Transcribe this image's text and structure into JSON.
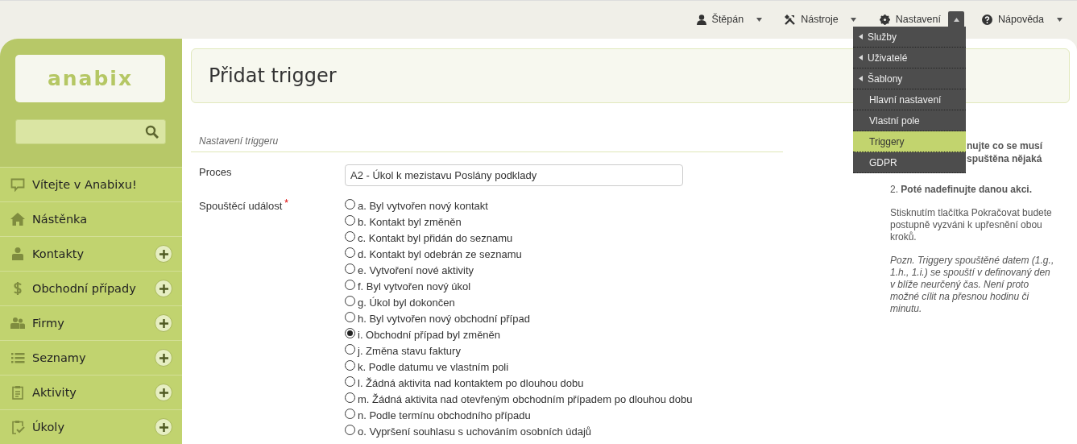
{
  "topbar": {
    "items": [
      {
        "label": "Štěpán",
        "expanded": false
      },
      {
        "label": "Nástroje",
        "expanded": false
      },
      {
        "label": "Nastavení",
        "expanded": true
      },
      {
        "label": "Nápověda",
        "expanded": false
      }
    ]
  },
  "settings_menu": {
    "items": [
      {
        "label": "Služby",
        "submenu": true,
        "selected": false
      },
      {
        "label": "Uživatelé",
        "submenu": true,
        "selected": false
      },
      {
        "label": "Šablony",
        "submenu": true,
        "selected": false
      },
      {
        "label": "Hlavní nastavení",
        "submenu": false,
        "selected": false
      },
      {
        "label": "Vlastní pole",
        "submenu": false,
        "selected": false
      },
      {
        "label": "Triggery",
        "submenu": false,
        "selected": true
      },
      {
        "label": "GDPR",
        "submenu": false,
        "selected": false
      }
    ]
  },
  "sidebar": {
    "logo": "anabix",
    "items": [
      {
        "label": "Vítejte v Anabixu!",
        "add_button": false
      },
      {
        "label": "Nástěnka",
        "add_button": false
      },
      {
        "label": "Kontakty",
        "add_button": true
      },
      {
        "label": "Obchodní případy",
        "add_button": true
      },
      {
        "label": "Firmy",
        "add_button": true
      },
      {
        "label": "Seznamy",
        "add_button": true
      },
      {
        "label": "Aktivity",
        "add_button": true
      },
      {
        "label": "Úkoly",
        "add_button": true
      }
    ]
  },
  "page": {
    "title": "Přidat trigger"
  },
  "form": {
    "section": "Nastavení triggeru",
    "process": {
      "label": "Proces",
      "value": "A2 - Úkol k mezistavu Poslány podklady"
    },
    "event": {
      "label": "Spouštěcí událost",
      "required_mark": "*",
      "options": [
        {
          "label": "a. Byl vytvořen nový kontakt",
          "selected": false
        },
        {
          "label": "b. Kontakt byl změněn",
          "selected": false
        },
        {
          "label": "c. Kontakt byl přidán do seznamu",
          "selected": false
        },
        {
          "label": "d. Kontakt byl odebrán ze seznamu",
          "selected": false
        },
        {
          "label": "e. Vytvoření nové aktivity",
          "selected": false
        },
        {
          "label": "f. Byl vytvořen nový úkol",
          "selected": false
        },
        {
          "label": "g. Úkol byl dokončen",
          "selected": false
        },
        {
          "label": "h. Byl vytvořen nový obchodní případ",
          "selected": false
        },
        {
          "label": "i. Obchodní případ byl změněn",
          "selected": true
        },
        {
          "label": "j. Změna stavu faktury",
          "selected": false
        },
        {
          "label": "k. Podle datumu ve vlastním poli",
          "selected": false
        },
        {
          "label": "l. Žádná aktivita nad kontaktem po dlouhou dobu",
          "selected": false
        },
        {
          "label": "m. Žádná aktivita nad otevřeným obchodním případem po dlouhou dobu",
          "selected": false
        },
        {
          "label": "n. Podle termínu obchodního případu",
          "selected": false
        },
        {
          "label": "o. Vypršení souhlasu s uchováním osobních údajů",
          "selected": false
        }
      ]
    }
  },
  "help": {
    "covered_lines": [
      "nujte co se musí",
      "spuštěna nějaká"
    ],
    "step": "2. **Poté nadefinujte danou akci.**",
    "text": "Stisknutím tlačítka Pokračovat budete postupně vyzváni k upřesnění obou kroků.",
    "note": "Pozn. Triggery spouštěné datem (1.g., 1.h., 1.i.) se spouští v definovaný den v blíže neurčený čas. Není proto možné cílit na přesnou hodinu či minutu."
  }
}
